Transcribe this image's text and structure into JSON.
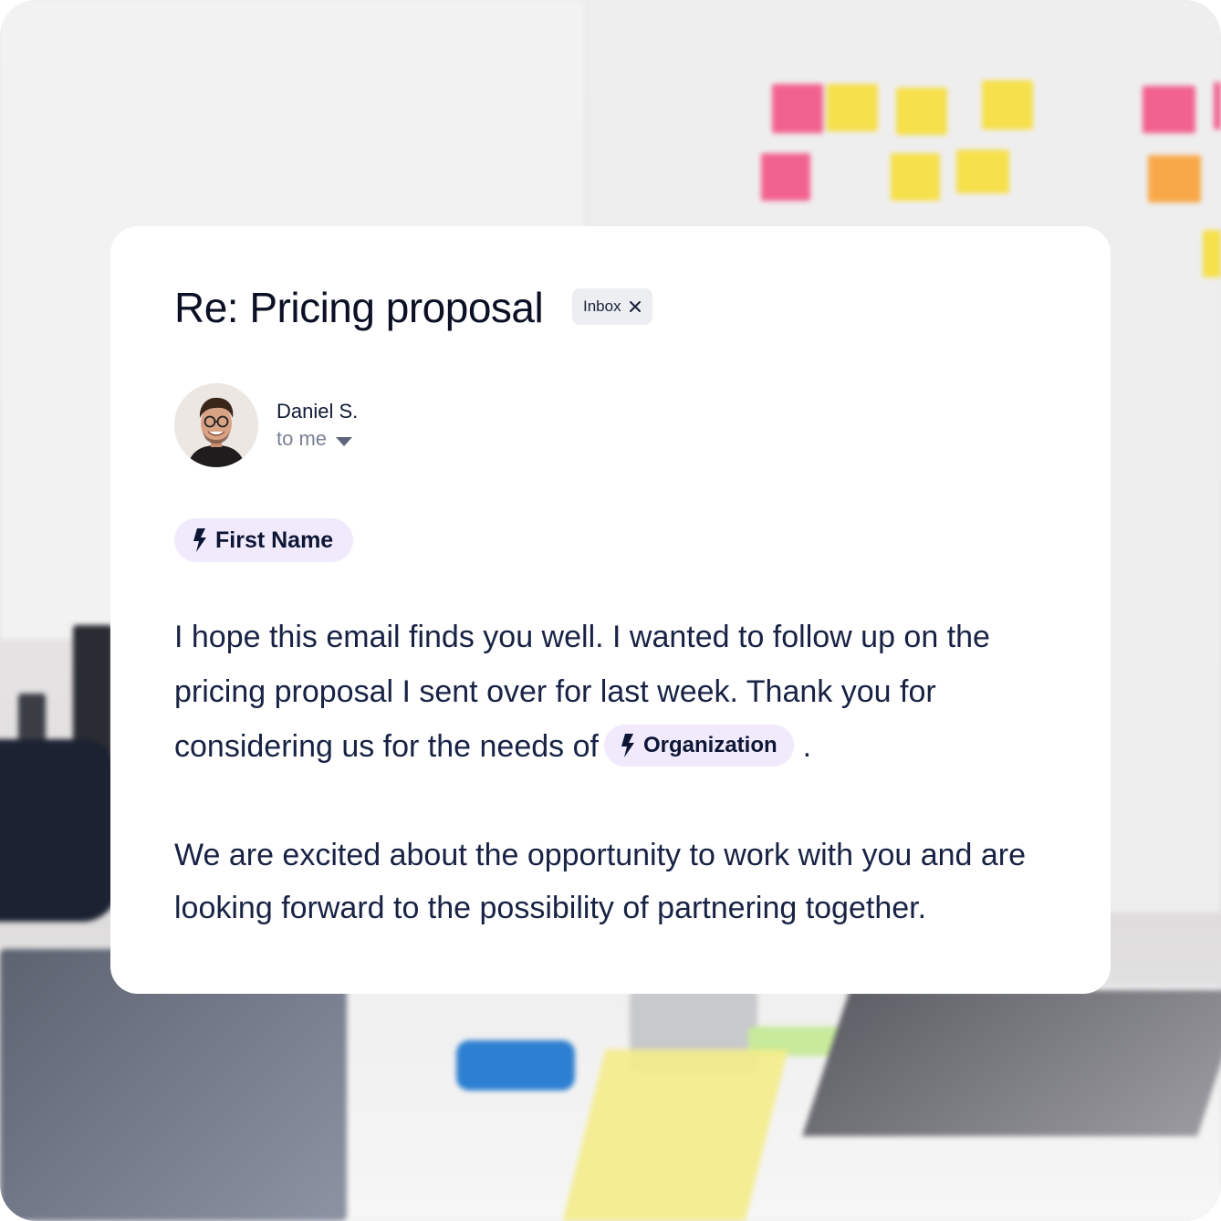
{
  "email": {
    "subject": "Re: Pricing proposal",
    "label_badge": "Inbox",
    "sender_name": "Daniel S.",
    "recipient": "to me",
    "first_name_token": "First Name",
    "body_part1": "I hope this email finds you well. I wanted to follow up on the pricing proposal I sent over for last week. Thank you for considering us for the needs of",
    "organization_token": "Organization",
    "body_part1_end": ".",
    "body_part2": "We are excited about the opportunity to work with you and are looking forward to the possibility of partnering together."
  },
  "icons": {
    "badge_remove": "close-icon",
    "recipient_toggle": "chevron-down-icon",
    "token": "lightning-bolt-icon",
    "avatar": "avatar-photo"
  },
  "colors": {
    "token_background": "#f1eafd",
    "text_primary": "#0b1025",
    "text_muted": "#7a8196",
    "badge_background": "#eceef1"
  }
}
